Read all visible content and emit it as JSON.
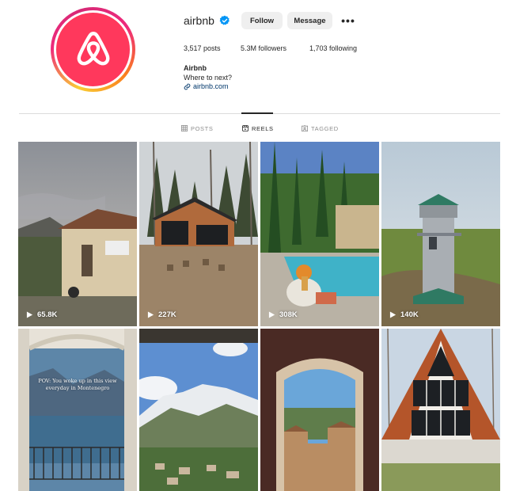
{
  "profile": {
    "username": "airbnb",
    "verified": true,
    "follow_label": "Follow",
    "message_label": "Message",
    "more_label": "•••",
    "posts_count": "3,517",
    "posts_label": "posts",
    "followers_count": "5.3M",
    "followers_label": "followers",
    "following_count": "1,703",
    "following_label": "following",
    "bio_name": "Airbnb",
    "bio_text": "Where to next?",
    "bio_link": "airbnb.com",
    "brand_color": "#ff385c"
  },
  "tabs": [
    {
      "label": "POSTS",
      "icon": "grid-icon",
      "active": false
    },
    {
      "label": "REELS",
      "icon": "reels-icon",
      "active": true
    },
    {
      "label": "TAGGED",
      "icon": "tagged-icon",
      "active": false
    }
  ],
  "reels": [
    {
      "views": "65.8K",
      "scene": "villa at dusk"
    },
    {
      "views": "227K",
      "scene": "modern cabin in forest"
    },
    {
      "views": "308K",
      "scene": "pool in garden"
    },
    {
      "views": "140K",
      "scene": "lighthouse"
    },
    {
      "overlay": "POV: You woke up in this view everyday in Montenegro",
      "scene": "balcony lake view"
    },
    {
      "scene": "snowy mountains over town"
    },
    {
      "scene": "arched window over village"
    },
    {
      "scene": "A-frame house"
    }
  ]
}
